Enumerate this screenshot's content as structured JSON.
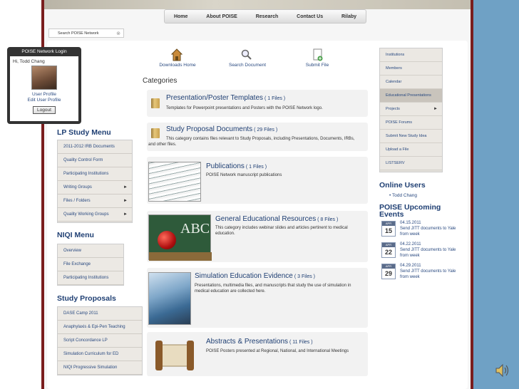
{
  "nav": {
    "items": [
      "Home",
      "About POISE",
      "Research",
      "Contact Us",
      "Rilaby"
    ]
  },
  "search": {
    "placeholder": "Search POISE Network",
    "close": "⊗"
  },
  "login": {
    "title": "POISE Network Login",
    "greeting": "Hi, Todd Chang",
    "user_profile": "User Profile",
    "edit_profile": "Edit User Profile",
    "logout": "Logout"
  },
  "lp_menu": {
    "title": "LP Study Menu",
    "items": [
      {
        "label": "2011-2012 IRB Documents",
        "arrow": ""
      },
      {
        "label": "Quality Control Form",
        "arrow": ""
      },
      {
        "label": "Participating Institutions",
        "arrow": ""
      },
      {
        "label": "Writing Groups",
        "arrow": "►"
      },
      {
        "label": "Files / Folders",
        "arrow": "►"
      },
      {
        "label": "Quality Working Groups",
        "arrow": "►"
      }
    ]
  },
  "niqi_menu": {
    "title": "NIQI Menu",
    "items": [
      "Overview",
      "File Exchange",
      "Participating Institutions"
    ]
  },
  "study_menu": {
    "title": "Study Proposals",
    "items": [
      "DASE Camp 2011",
      "Anaphylaxis & Epi-Pen Teaching",
      "Script Concordance LP",
      "Simulation Curriculum for ED",
      "NIQI Progressive Simulation"
    ]
  },
  "quick": {
    "downloads": "Downloads Home",
    "search": "Search Document",
    "submit": "Submit File"
  },
  "categories_title": "Categories",
  "categories": [
    {
      "title": "Presentation/Poster Templates",
      "count": "( 1 Files )",
      "desc": "Templates for Powerpoint presentations and Posters with the POISE Network logo."
    },
    {
      "title": "Study Proposal Documents",
      "count": "( 29 Files )",
      "desc": "This category contains files relevant to Study Proposals, including Presentations, Documents, IRBs, and other files."
    },
    {
      "title": "Publications",
      "count": "( 1 Files )",
      "desc": "POISE Network manuscript publications"
    },
    {
      "title": "General Educational Resources",
      "count": "( 8 Files )",
      "desc": "This category includes webinar slides and articles pertinent to medical education."
    },
    {
      "title": "Simulation Education Evidence",
      "count": "( 3 Files )",
      "desc": "Presentations, multimedia files, and manuscripts that study the use of simulation in medical education are collected here."
    },
    {
      "title": "Abstracts & Presentations",
      "count": "( 11 Files )",
      "desc": "POISE Posters presented at Regional, National, and International Meetings"
    }
  ],
  "abc": "ABC",
  "right_menu": {
    "items": [
      {
        "label": "Institutions",
        "arrow": ""
      },
      {
        "label": "Members",
        "arrow": ""
      },
      {
        "label": "Calendar",
        "arrow": ""
      },
      {
        "label": "Educational Presentations",
        "arrow": ""
      },
      {
        "label": "Projects",
        "arrow": "►"
      },
      {
        "label": "POISE Forums",
        "arrow": ""
      },
      {
        "label": "Submit New Study Idea",
        "arrow": ""
      },
      {
        "label": "Upload a File",
        "arrow": ""
      },
      {
        "label": "LISTSERV",
        "arrow": ""
      }
    ]
  },
  "online": {
    "title": "Online Users",
    "users": [
      "Todd Chang"
    ]
  },
  "events": {
    "title": "POISE Upcoming Events",
    "items": [
      {
        "month": "APR",
        "day": "15",
        "date": "04.15.2011",
        "text": "Send JITT documents to Yale from week"
      },
      {
        "month": "APR",
        "day": "22",
        "date": "04.22.2011",
        "text": "Send JITT documents to Yale from week"
      },
      {
        "month": "APR",
        "day": "29",
        "date": "04.29.2011",
        "text": "Send JITT documents to Yale from week"
      }
    ]
  },
  "colors": {
    "frame": "#7a1e1e",
    "accent": "#1f3f73",
    "side": "#6fa1c5"
  }
}
